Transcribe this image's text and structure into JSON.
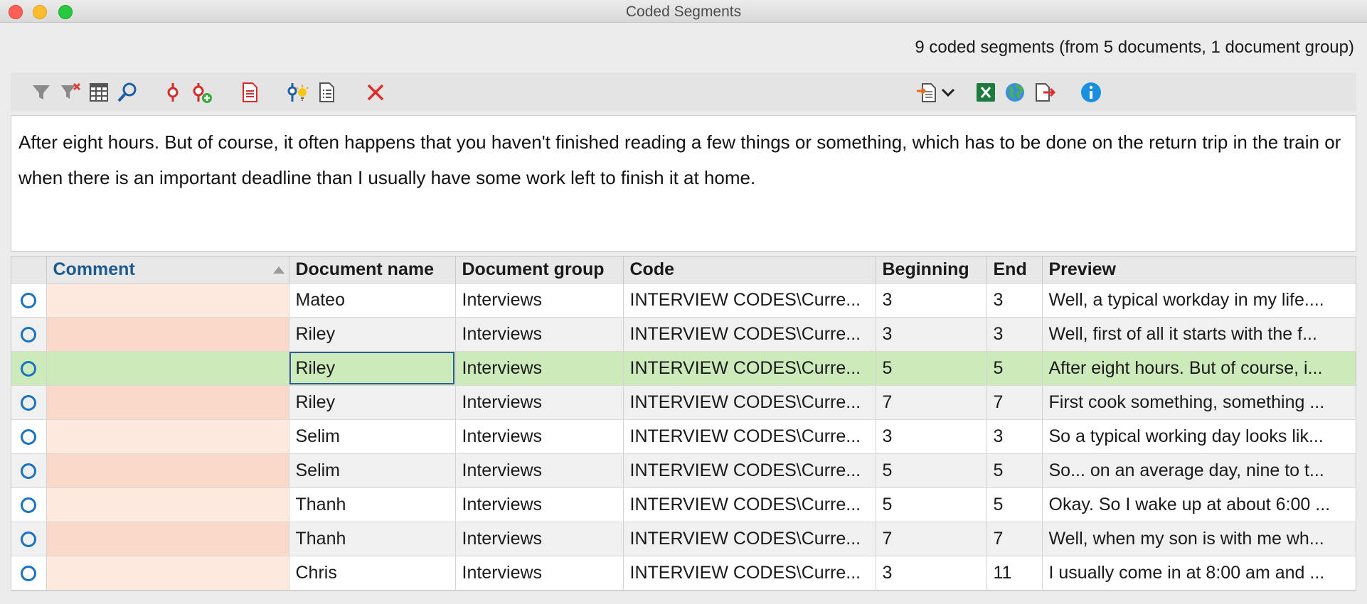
{
  "window": {
    "title": "Coded Segments"
  },
  "summary": "9 coded segments (from 5 documents, 1 document group)",
  "toolbar": {
    "icons": [
      "filter-icon",
      "clear-filter-icon",
      "columns-icon",
      "search-icon",
      "activate-code-icon",
      "add-code-icon",
      "document-icon",
      "smart-coding-icon",
      "list-document-icon",
      "delete-icon",
      "import-icon",
      "excel-export-icon",
      "web-export-icon",
      "export-icon",
      "info-icon"
    ]
  },
  "preview_text": "After eight hours. But of course, it often happens that you haven't finished reading a few things or something, which has to be done on the return trip in the train or when there is an important deadline than I usually have some work left to finish it at home.",
  "table": {
    "columns": [
      "",
      "Comment",
      "Document name",
      "Document group",
      "Code",
      "Beginning",
      "End",
      "Preview"
    ],
    "sort": {
      "column": "Comment",
      "direction": "ascending"
    },
    "selected_row": 2,
    "rows": [
      {
        "comment": "",
        "document": "Mateo",
        "group": "Interviews",
        "code": "INTERVIEW CODES\\Curre...",
        "beginning": "3",
        "end": "3",
        "preview": "Well, a typical workday in my life...."
      },
      {
        "comment": "",
        "document": "Riley",
        "group": "Interviews",
        "code": "INTERVIEW CODES\\Curre...",
        "beginning": "3",
        "end": "3",
        "preview": "Well, first of all it starts with the f..."
      },
      {
        "comment": "",
        "document": "Riley",
        "group": "Interviews",
        "code": "INTERVIEW CODES\\Curre...",
        "beginning": "5",
        "end": "5",
        "preview": "After eight hours. But of course, i..."
      },
      {
        "comment": "",
        "document": "Riley",
        "group": "Interviews",
        "code": "INTERVIEW CODES\\Curre...",
        "beginning": "7",
        "end": "7",
        "preview": "First cook something, something ..."
      },
      {
        "comment": "",
        "document": "Selim",
        "group": "Interviews",
        "code": "INTERVIEW CODES\\Curre...",
        "beginning": "3",
        "end": "3",
        "preview": "So a typical working day looks lik..."
      },
      {
        "comment": "",
        "document": "Selim",
        "group": "Interviews",
        "code": "INTERVIEW CODES\\Curre...",
        "beginning": "5",
        "end": "5",
        "preview": "So... on an average day, nine to t..."
      },
      {
        "comment": "",
        "document": "Thanh",
        "group": "Interviews",
        "code": "INTERVIEW CODES\\Curre...",
        "beginning": "5",
        "end": "5",
        "preview": "Okay. So I wake up at about 6:00 ..."
      },
      {
        "comment": "",
        "document": "Thanh",
        "group": "Interviews",
        "code": "INTERVIEW CODES\\Curre...",
        "beginning": "7",
        "end": "7",
        "preview": "Well, when my son is with me wh..."
      },
      {
        "comment": "",
        "document": "Chris",
        "group": "Interviews",
        "code": "INTERVIEW CODES\\Curre...",
        "beginning": "3",
        "end": "11",
        "preview": "I usually come in at 8:00 am and ..."
      }
    ]
  }
}
